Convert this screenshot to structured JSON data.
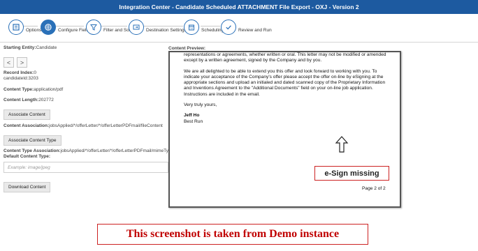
{
  "window": {
    "title": "Integration Center - Candidate Scheduled ATTACHMENT File Export - OXJ - Version 2"
  },
  "wizard": {
    "steps": [
      {
        "label": "Options",
        "icon": "options-icon",
        "active": false
      },
      {
        "label": "Configure Fields",
        "icon": "grid-icon",
        "active": true
      },
      {
        "label": "Filter and Sort",
        "icon": "filter-icon",
        "active": false
      },
      {
        "label": "Destination Settings",
        "icon": "destination-icon",
        "active": false
      },
      {
        "label": "Scheduling",
        "icon": "calendar-icon",
        "active": false
      },
      {
        "label": "Review and Run",
        "icon": "checkmark-icon",
        "active": false
      }
    ]
  },
  "left": {
    "starting_entity_label": "Starting Entity:",
    "starting_entity_value": "Candidate",
    "prev_label": "<",
    "next_label": ">",
    "record_index_label": "Record Index:",
    "record_index_value": "0",
    "candidate_id": "candidateId:3203",
    "content_type_label": "Content Type:",
    "content_type_value": "application/pdf",
    "content_length_label": "Content Length:",
    "content_length_value": "202772",
    "associate_content_button": "Associate Content",
    "content_association_label": "Content Association:",
    "content_association_value": "jobsApplied/*/offerLetter/*/offerLetterPDFmail/fileContent",
    "associate_content_type_button": "Associate Content Type",
    "content_type_association_label": "Content Type Association:",
    "content_type_association_value": "jobsApplied/*/offerLetter/*/offerLetterPDFmail/mimeType",
    "default_content_type_label": "Default Content Type:",
    "default_content_type_placeholder": "Example: image/jpeg",
    "download_content_button": "Download Content"
  },
  "preview": {
    "label": "Content Preview:",
    "para1": "representations or agreements, whether written or oral.  This letter may not be modified or amended except by a written agreement, signed by the Company and by you.",
    "para2": "We are all delighted to be able to extend you this offer and look forward to working with you.  To indicate your acceptance of the Company's offer please accept the offer on-line by eSigning at the appropriate sections and upload an initialed and dated scanned copy of the Proprietary Information and Inventions Agreement to the \"Additional Documents\" field on your on-line job application. Instructions are included in the email.",
    "closing": "Very truly yours,",
    "signer_name": "Jeff Ho",
    "signer_company": "Best Run",
    "page_number": "Page 2 of 2"
  },
  "annotations": {
    "esign_missing": "e-Sign missing",
    "demo_note": "This screenshot is taken from Demo instance"
  },
  "colors": {
    "title_bar": "#1d5aa0",
    "accent": "#2a70b8",
    "annotation_border": "#cc2222",
    "note_text": "#c00000"
  }
}
